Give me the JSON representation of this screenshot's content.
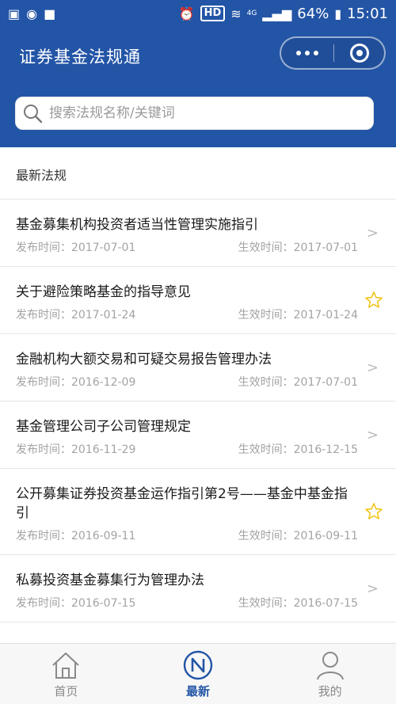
{
  "status_bar": {
    "network": "HD",
    "signal_type": "4G",
    "battery": "64%",
    "time": "15:01"
  },
  "header": {
    "title": "证券基金法规通",
    "search_placeholder": "搜索法规名称/关键词"
  },
  "section": {
    "title": "最新法规"
  },
  "laws": [
    {
      "title": "基金募集机构投资者适当性管理实施指引",
      "publish_label": "发布时间：",
      "publish_date": "2017-07-01",
      "effective_label": "生效时间：",
      "effective_date": "2017-07-01",
      "indicator": "chevron"
    },
    {
      "title": "关于避险策略基金的指导意见",
      "publish_label": "发布时间：",
      "publish_date": "2017-01-24",
      "effective_label": "生效时间：",
      "effective_date": "2017-01-24",
      "indicator": "star"
    },
    {
      "title": "金融机构大额交易和可疑交易报告管理办法",
      "publish_label": "发布时间：",
      "publish_date": "2016-12-09",
      "effective_label": "生效时间：",
      "effective_date": "2017-07-01",
      "indicator": "chevron"
    },
    {
      "title": "基金管理公司子公司管理规定",
      "publish_label": "发布时间：",
      "publish_date": "2016-11-29",
      "effective_label": "生效时间：",
      "effective_date": "2016-12-15",
      "indicator": "chevron"
    },
    {
      "title": "公开募集证券投资基金运作指引第2号——基金中基金指引",
      "publish_label": "发布时间：",
      "publish_date": "2016-09-11",
      "effective_label": "生效时间：",
      "effective_date": "2016-09-11",
      "indicator": "star"
    },
    {
      "title": "私募投资基金募集行为管理办法",
      "publish_label": "发布时间：",
      "publish_date": "2016-07-15",
      "effective_label": "生效时间：",
      "effective_date": "2016-07-15",
      "indicator": "chevron"
    }
  ],
  "tabbar": [
    {
      "label": "首页",
      "icon": "home-icon",
      "active": false
    },
    {
      "label": "最新",
      "icon": "new-icon",
      "active": true
    },
    {
      "label": "我的",
      "icon": "user-icon",
      "active": false
    }
  ],
  "colors": {
    "brand": "#2355a6",
    "star": "#f0c419",
    "meta_text": "#a3a3a3"
  }
}
